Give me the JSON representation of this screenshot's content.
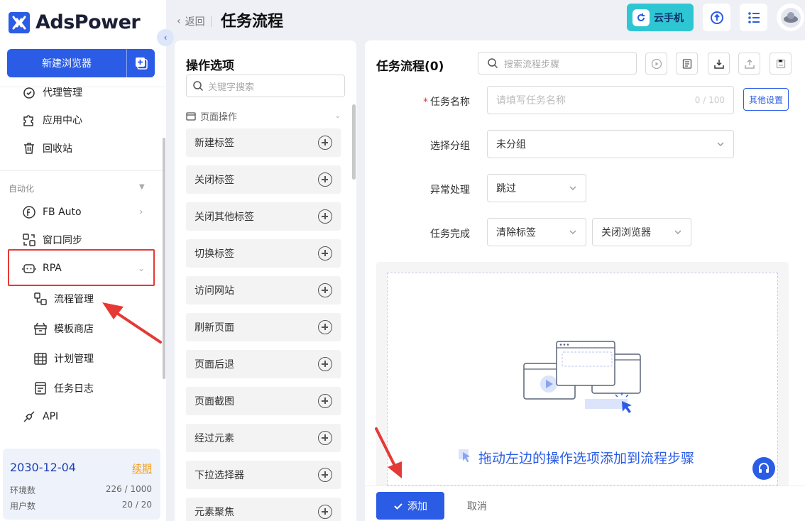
{
  "app": {
    "brand": "AdsPower",
    "new_browser_label": "新建浏览器"
  },
  "header": {
    "back_label": "返回",
    "title": "任务流程",
    "cloud_phone_label": "云手机"
  },
  "sidebar": {
    "top_items": [
      {
        "label": "代理管理",
        "icon": "proxy-icon"
      },
      {
        "label": "应用中心",
        "icon": "puzzle-icon"
      },
      {
        "label": "回收站",
        "icon": "trash-icon"
      }
    ],
    "section_label": "自动化",
    "auto_items": [
      {
        "label": "FB Auto",
        "icon": "fb-auto-icon"
      },
      {
        "label": "窗口同步",
        "icon": "window-sync-icon"
      },
      {
        "label": "RPA",
        "icon": "robot-icon"
      }
    ],
    "rpa_sub_items": [
      {
        "label": "流程管理",
        "icon": "flow-icon"
      },
      {
        "label": "模板商店",
        "icon": "store-icon"
      },
      {
        "label": "计划管理",
        "icon": "calendar-icon"
      },
      {
        "label": "任务日志",
        "icon": "log-icon"
      }
    ],
    "api_label": "API",
    "plan": {
      "expiry": "2030-12-04",
      "renew": "续期",
      "env_label": "环境数",
      "env_value": "226 / 1000",
      "user_label": "用户数",
      "user_value": "20 / 20"
    }
  },
  "options_panel": {
    "title": "操作选项",
    "search_placeholder": "关键字搜索",
    "group": "页面操作",
    "items": [
      "新建标签",
      "关闭标签",
      "关闭其他标签",
      "切换标签",
      "访问网站",
      "刷新页面",
      "页面后退",
      "页面截图",
      "经过元素",
      "下拉选择器",
      "元素聚焦"
    ]
  },
  "flow_panel": {
    "title": "任务流程(0)",
    "search_placeholder": "搜索流程步骤",
    "form": {
      "task_name_label": "任务名称",
      "task_name_placeholder": "请填写任务名称",
      "task_name_count": "0 / 100",
      "other_settings": "其他设置",
      "group_label": "选择分组",
      "group_value": "未分组",
      "error_label": "异常处理",
      "error_value": "跳过",
      "complete_label": "任务完成",
      "complete_value_1": "清除标签",
      "complete_value_2": "关闭浏览器"
    },
    "drop_hint": "拖动左边的操作选项添加到流程步骤",
    "add_label": "添加",
    "cancel_label": "取消"
  },
  "colors": {
    "accent": "#2a5ce6",
    "highlight": "#e53935",
    "renew": "#f0a020",
    "cloud_phone": "#2fc6d3"
  }
}
